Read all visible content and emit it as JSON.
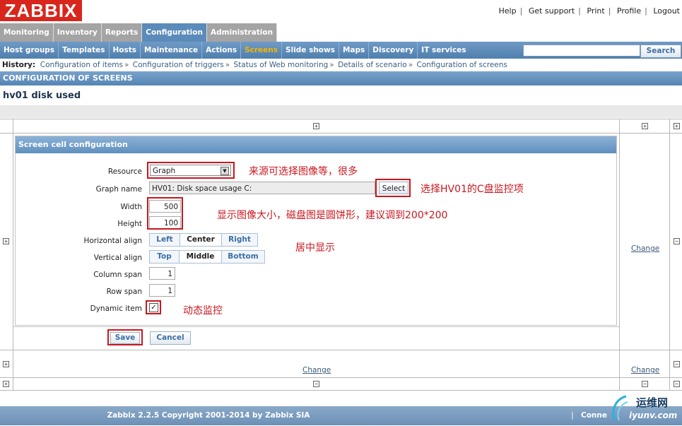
{
  "logo": "ZABBIX",
  "top_links": [
    "Help",
    "Get support",
    "Print",
    "Profile",
    "Logout"
  ],
  "main_tabs": [
    "Monitoring",
    "Inventory",
    "Reports",
    "Configuration",
    "Administration"
  ],
  "main_tab_active": "Configuration",
  "sub_menu": [
    "Host groups",
    "Templates",
    "Hosts",
    "Maintenance",
    "Actions",
    "Screens",
    "Slide shows",
    "Maps",
    "Discovery",
    "IT services"
  ],
  "sub_menu_active": "Screens",
  "search": {
    "value": "",
    "button": "Search"
  },
  "history": {
    "label": "History:",
    "items": [
      "Configuration of items",
      "Configuration of triggers",
      "Status of Web monitoring",
      "Details of scenario",
      "Configuration of screens"
    ]
  },
  "section_title": "CONFIGURATION OF SCREENS",
  "screen_name": "hv01 disk used",
  "grid": {
    "change_label": "Change"
  },
  "form": {
    "title": "Screen cell configuration",
    "resource": {
      "label": "Resource",
      "value": "Graph"
    },
    "graph_name": {
      "label": "Graph name",
      "value": "HV01: Disk space usage C:",
      "select_button": "Select"
    },
    "width": {
      "label": "Width",
      "value": "500"
    },
    "height": {
      "label": "Height",
      "value": "100"
    },
    "halign": {
      "label": "Horizontal align",
      "options": [
        "Left",
        "Center",
        "Right"
      ],
      "selected": "Center"
    },
    "valign": {
      "label": "Vertical align",
      "options": [
        "Top",
        "Middle",
        "Bottom"
      ],
      "selected": "Middle"
    },
    "colspan": {
      "label": "Column span",
      "value": "1"
    },
    "rowspan": {
      "label": "Row span",
      "value": "1"
    },
    "dynamic": {
      "label": "Dynamic item",
      "checked": true
    },
    "save": "Save",
    "cancel": "Cancel"
  },
  "annotations": {
    "resource": "来源可选择图像等，很多",
    "select": "选择HV01的C盘监控项",
    "size": "显示图像大小，磁盘图是圆饼形，建议调到200*200",
    "align": "居中显示",
    "dynamic": "动态监控"
  },
  "footer": {
    "copyright": "Zabbix 2.2.5 Copyright 2001-2014 by Zabbix SIA",
    "connected": "Conne"
  },
  "watermark": {
    "text1": "运维网",
    "text2": "iyunv.com"
  },
  "colors": {
    "accent": "#5a8bba",
    "annotation": "#c8171e",
    "logo": "#d9261c",
    "active_sub": "#f3b500"
  }
}
